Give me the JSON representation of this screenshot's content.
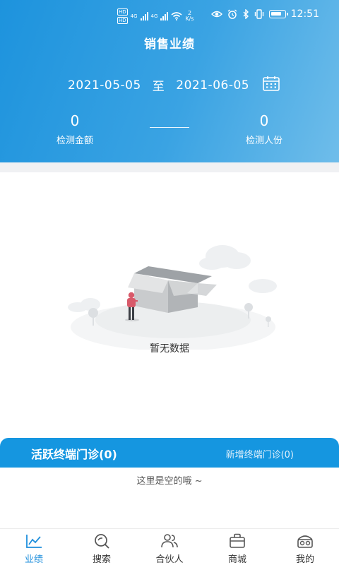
{
  "status_bar": {
    "left_badges": [
      "HD",
      "HD"
    ],
    "network_label": "4G",
    "net_speed_value": "2",
    "net_speed_unit": "K/s",
    "time": "12:51",
    "icons": [
      "eye-icon",
      "alarm-icon",
      "bluetooth-icon",
      "vibrate-icon",
      "battery-icon"
    ]
  },
  "header": {
    "title": "销售业绩",
    "start_date": "2021-05-05",
    "date_separator": "至",
    "end_date": "2021-06-05",
    "calendar_icon": "calendar-icon",
    "stats": [
      {
        "value": "0",
        "label": "检测金额"
      },
      {
        "value": "0",
        "label": "检测人份"
      }
    ]
  },
  "empty_state": {
    "illustration": "empty-box-illustration",
    "text": "暂无数据"
  },
  "active_clinics": {
    "title": "活跃终端门诊(0)",
    "new_label": "新增终端门诊(0)",
    "empty_text": "这里是空的哦 ~"
  },
  "tabbar": {
    "items": [
      {
        "label": "业绩",
        "icon": "chart-icon",
        "active": true
      },
      {
        "label": "搜索",
        "icon": "search-icon",
        "active": false
      },
      {
        "label": "合伙人",
        "icon": "partners-icon",
        "active": false
      },
      {
        "label": "商城",
        "icon": "shop-icon",
        "active": false
      },
      {
        "label": "我的",
        "icon": "profile-icon",
        "active": false
      }
    ]
  },
  "colors": {
    "header_gradient_start": "#1d93dd",
    "header_gradient_end": "#6fbdea",
    "accent": "#1596e0",
    "tab_active": "#1f8fdc"
  }
}
